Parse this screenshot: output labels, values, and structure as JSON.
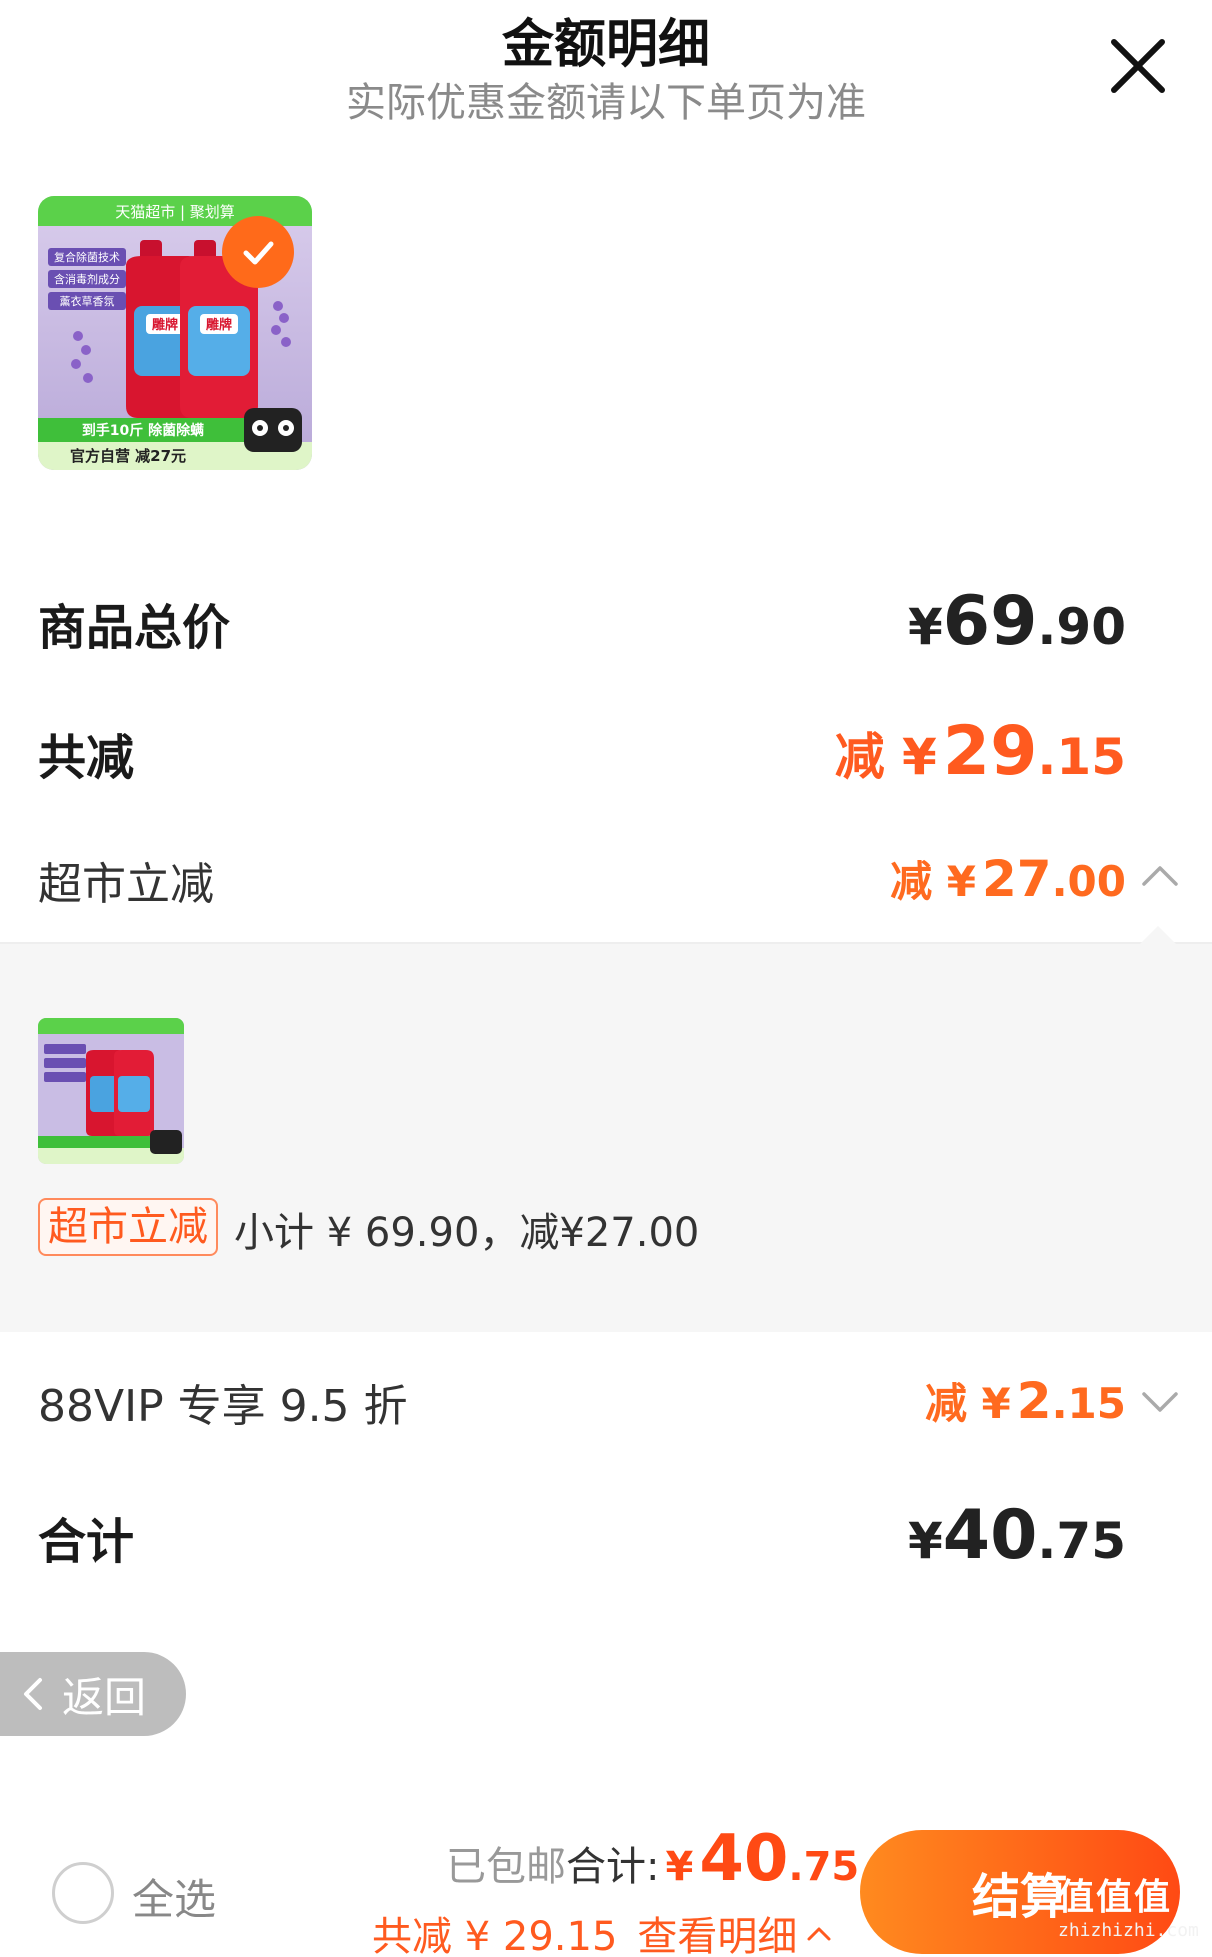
{
  "header": {
    "title": "金额明细",
    "subtitle": "实际优惠金额请以下单页为准"
  },
  "product": {
    "banner_text": "天猫超市 | 聚划算",
    "features": [
      "复合除菌技术",
      "含消毒剂成分",
      "薰衣草香氛"
    ],
    "promo_line": "到手10斤 除菌除螨",
    "store_line": "官方自营 减27元",
    "brand_mark": "雕牌"
  },
  "summary": {
    "total_price_label": "商品总价",
    "total_price_currency": "¥",
    "total_price_int": "69",
    "total_price_dec": ".90",
    "total_discount_label": "共减",
    "total_discount_prefix": "减 ¥",
    "total_discount_int": "29",
    "total_discount_dec": ".15",
    "supermarket_label": "超市立减",
    "supermarket_prefix": "减 ¥",
    "supermarket_int": "27",
    "supermarket_dec": ".00"
  },
  "detail": {
    "tag": "超市立减",
    "subtotal_text": "小计 ¥ 69.90，减¥27.00"
  },
  "vip": {
    "label": "88VIP 专享 9.5 折",
    "prefix": "减 ¥",
    "int": "2",
    "dec": ".15"
  },
  "total": {
    "label": "合计",
    "currency": "¥",
    "int": "40",
    "dec": ".75"
  },
  "back": {
    "label": "返回"
  },
  "bottom_bar": {
    "select_all": "全选",
    "shipping": "已包邮",
    "total_label": "合计:",
    "currency": "¥",
    "total_int": "40",
    "total_dec": ".75",
    "discount_text": "共减 ¥ 29.15",
    "view_detail": "查看明细",
    "checkout": "结算"
  },
  "watermark": {
    "text": "值值值",
    "url": "zhizhizhi.com"
  },
  "colors": {
    "accent": "#ff5a1f",
    "checkout_start": "#ff8a1f",
    "checkout_end": "#ff4a14",
    "panel_bg": "#f6f6f6"
  }
}
